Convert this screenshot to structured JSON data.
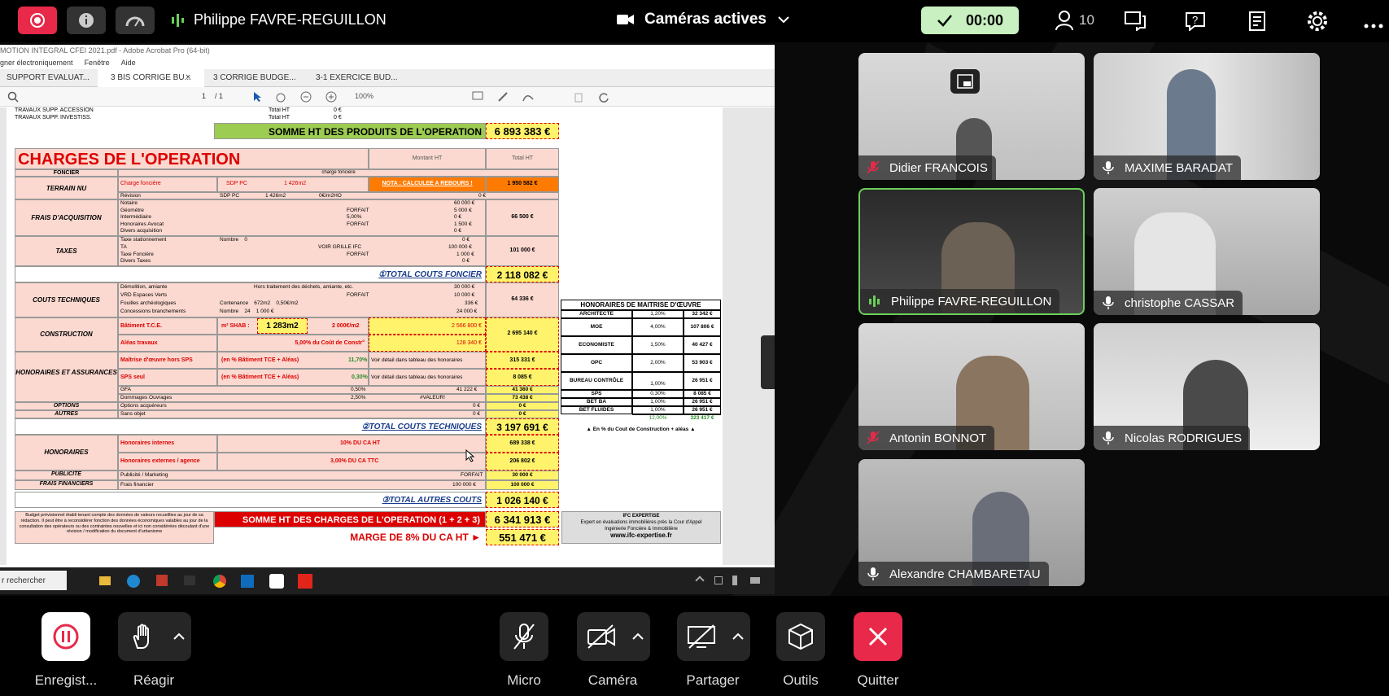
{
  "topbar": {
    "presenter": "Philippe FAVRE-REGUILLON",
    "cameras": "Caméras actives",
    "timer": "00:00",
    "participants": "10"
  },
  "pdf": {
    "window_title": "MOTION INTEGRAL CFEI 2021.pdf - Adobe Acrobat Pro (64-bit)",
    "menu": [
      "gner électroniquement",
      "Fenêtre",
      "Aide"
    ],
    "tabs": [
      "SUPPORT EVALUAT...",
      "3 BIS CORRIGE BU...",
      "3 CORRIGE BUDGE...",
      "3-1 EXERCICE BUD..."
    ],
    "page": "1",
    "page_total": "/ 1",
    "zoom": "100%",
    "rows_top": [
      "TRAVAUX SUPP. ACCESSION",
      "TRAVAUX SUPP. INVESTISS."
    ],
    "total_ht": "Total HT",
    "zero": "0 €",
    "somme_produits_label": "SOMME HT DES PRODUITS DE L'OPERATION",
    "somme_produits": "6 893 383 €",
    "charges_title": "CHARGES DE L'OPERATION",
    "col_montant": "Montant HT",
    "col_total": "Total HT",
    "foncier": "FONCIER",
    "charge_fonciere_small": "charge foncière",
    "terrain_nu": "TERRAIN NU",
    "charge_fonciere": "Charge foncière",
    "revision": "Révision",
    "sdp": "SDP PC",
    "sdp_val": "1 426m2",
    "sdp_rate": "0€/m2HO",
    "nota": "NOTA : CALCULEE A REBOURS !",
    "terrain_total": "1 950 582 €",
    "frais_acq": "FRAIS D'ACQUISITION",
    "frais_items": [
      "Notaire",
      "Géomètre",
      "Intermédiaire",
      "Honoraires Avocat",
      "Divers acquisition"
    ],
    "frais_mid": [
      "",
      "FORFAIT",
      "5,00%",
      "FORFAIT",
      ""
    ],
    "frais_vals": [
      "60 000 €",
      "5 000 €",
      "0 €",
      "1 500 €",
      "0 €"
    ],
    "frais_total": "66 500 €",
    "taxes": "TAXES",
    "taxes_items": [
      "Taxe stationnement",
      "TA",
      "Taxe Foncière",
      "Divers Taxes"
    ],
    "taxes_mid": [
      "Nombre    0",
      "VOIR GRILLE IFC",
      "FORFAIT",
      ""
    ],
    "taxes_vals": [
      "0 €",
      "100 000 €",
      "1 000 €",
      "0 €"
    ],
    "taxes_total": "101 000 €",
    "total_foncier_label": "①TOTAL COUTS FONCIER",
    "total_foncier": "2 118 082 €",
    "couts_tech": "COUTS TECHNIQUES",
    "ct_items": [
      "Démolition, amiante",
      "VRD Espaces Verts",
      "Fouilles archéologiques",
      "Concessions branchements"
    ],
    "ct_mid": [
      "Hors traitement des déchets, amiante, etc.",
      "FORFAIT",
      "Contenance    672m2    0,50€/m2",
      "Nombre    24    1 000 €"
    ],
    "ct_vals": [
      "30 000 €",
      "10 000 €",
      "336 €",
      "24 000 €"
    ],
    "ct_total": "64 336 €",
    "construction": "CONSTRUCTION",
    "bat_tce": "Bâtiment T.C.E.",
    "m2shab": "m² SHAB :",
    "shab_val": "1 283m2",
    "prix_m2": "2 000€/m2",
    "bat_val": "2 566 800 €",
    "aleas": "Aléas travaux",
    "aleas_pct": "5,00%  du Coût de Constr°",
    "aleas_val": "128 340 €",
    "constr_total": "2 695 140 €",
    "hono_ass": "HONORAIRES ET ASSURANCES",
    "moe_hors": "Maîtrise d'œuvre hors SPS",
    "pct_bat": "(en % Bâtiment TCE + Aléas)",
    "moe_pct": "11,70%",
    "voir_detail": "Voir détail dans tableau des honoraires",
    "moe_total": "315 331 €",
    "sps": "SPS seul",
    "sps_pct": "0,30%",
    "sps_total": "8 085 €",
    "gfa": "GFA",
    "gfa_pct": "0,50%",
    "gfa_val": "41 222 €",
    "gfa_total": "41 360 €",
    "dommages": "Dommages Ouvrages",
    "dom_pct": "2,50%",
    "dom_val": "#VALEUR!",
    "dom_total": "73 438 €",
    "options": "OPTIONS",
    "options_item": "Options acquéreurs",
    "autres": "AUTRES",
    "autres_item": "Sans objet",
    "total_tech_label": "②TOTAL COUTS TECHNIQUES",
    "total_tech": "3 197 691 €",
    "honoraires": "HONORAIRES",
    "hono_int": "Honoraires internes",
    "hono_int_mid": "10% DU CA HT",
    "hono_int_total": "689 338 €",
    "hono_ext": "Honoraires externes / agence",
    "hono_ext_mid": "3,00% DU CA TTC",
    "hono_ext_total": "206 802 €",
    "publicite": "PUBLICITE",
    "pub_item": "Publicité / Marketing",
    "pub_mid": "FORFAIT",
    "pub_total": "30 000 €",
    "frais_fin": "FRAIS FINANCIERS",
    "ff_item": "Frais financier",
    "ff_val": "100 000 €",
    "ff_total": "100 000 €",
    "total_autres_label": "③TOTAL AUTRES COUTS",
    "total_autres": "1 026 140 €",
    "disclaimer": "Budget prévisionnel établi tenant compte des données de valeurs recueillies au jour de sa rédaction. Il peut être à reconsidérer fonction des données économiques valables au jour de la consultation des opérateurs ou des contraintes nouvelles et ici non considérées découlant d'une révision / modification du document d'urbanisme",
    "somme_charges_label": "SOMME HT DES CHARGES DE L'OPERATION (1 + 2 + 3)",
    "somme_charges": "6 341 913 €",
    "marge_label": "MARGE DE 8% DU CA HT ►",
    "marge": "551 471 €",
    "ifc": [
      "IFC EXPERTISE",
      "Expert en évaluations immobilières près la Cour d'Appel",
      "Ingénierie Foncière & Immobilière",
      "www.ifc-expertise.fr"
    ],
    "hono_table_title": "HONORAIRES DE MAITRISE D'ŒUVRE",
    "hono_table": [
      [
        "ARCHITECTE",
        "1,20%",
        "32 342 €"
      ],
      [
        "MOE",
        "4,00%",
        "107 806 €"
      ],
      [
        "ECONOMISTE",
        "1,50%",
        "40 427 €"
      ],
      [
        "OPC",
        "2,00%",
        "53 903 €"
      ],
      [
        "BUREAU CONTRÔLE",
        "1,00%",
        "26 951 €"
      ],
      [
        "SPS",
        "0,30%",
        "8 085 €"
      ],
      [
        "BET BA",
        "1,00%",
        "26 951 €"
      ],
      [
        "BET FLUIDES",
        "1,00%",
        "26 951 €"
      ],
      [
        "",
        "12,00%",
        "323 417 €"
      ]
    ],
    "hono_note": "▲ En % du Cout de Construction + aléas ▲"
  },
  "taskbar": {
    "search": "r rechercher"
  },
  "participants": [
    {
      "name": "Didier FRANCOIS",
      "muted": true
    },
    {
      "name": "MAXIME BARADAT",
      "muted": false
    },
    {
      "name": "Philippe FAVRE-REGUILLON",
      "muted": false,
      "speaking": true
    },
    {
      "name": "christophe CASSAR",
      "muted": false
    },
    {
      "name": "Antonin BONNOT",
      "muted": true
    },
    {
      "name": "Nicolas RODRIGUES",
      "muted": false
    },
    {
      "name": "Alexandre CHAMBARETAU",
      "muted": false
    }
  ],
  "controls": {
    "record": "Enregist...",
    "react": "Réagir",
    "mic": "Micro",
    "camera": "Caméra",
    "share": "Partager",
    "tools": "Outils",
    "quit": "Quitter"
  },
  "colors": {
    "record": "#e8294a",
    "quit": "#e8294a",
    "timer_bg": "#c8f0c0",
    "speaking": "#6bcf5a",
    "yellow": "#fff36b",
    "pink": "#fbd9d0",
    "green": "#9ccc52"
  }
}
